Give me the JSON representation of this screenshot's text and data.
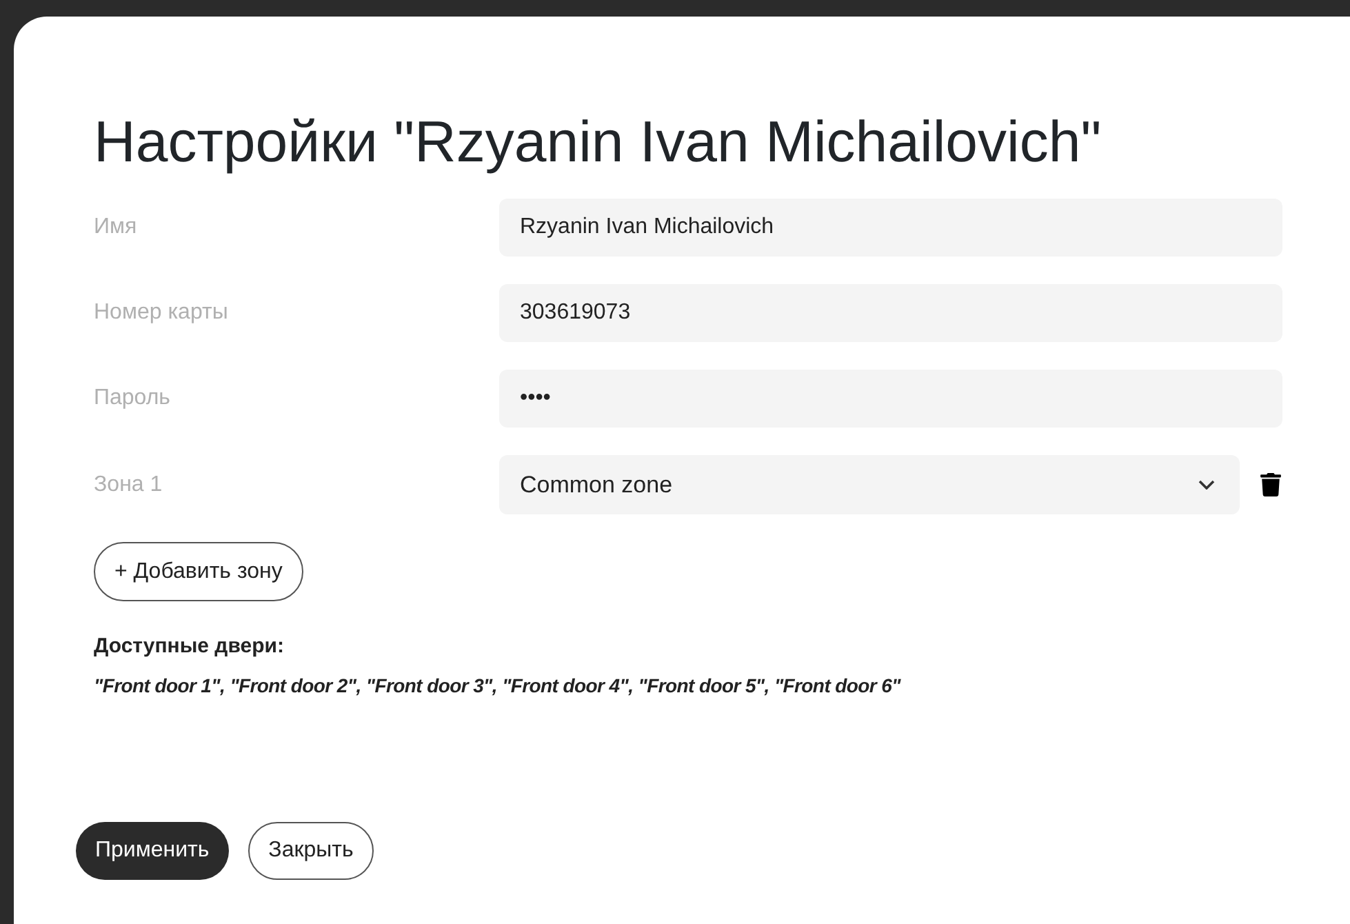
{
  "title": "Настройки \"Rzyanin Ivan Michailovich\"",
  "fields": [
    {
      "kind": "text",
      "label": "Имя",
      "value": "Rzyanin Ivan Michailovich"
    },
    {
      "kind": "text",
      "label": "Номер карты",
      "value": "303619073"
    },
    {
      "kind": "text",
      "label": "Пароль",
      "value": "••••"
    },
    {
      "kind": "select",
      "label": "Зона 1",
      "value": "Common zone"
    }
  ],
  "add_zone_button": "+ Добавить зону",
  "doors": {
    "heading": "Доступные двери:",
    "list": "\"Front door 1\", \"Front door 2\", \"Front door 3\", \"Front door 4\", \"Front door 5\", \"Front door 6\""
  },
  "buttons": [
    {
      "kind": "primary",
      "label": "Применить"
    },
    {
      "kind": "secondary",
      "label": "Закрыть"
    }
  ]
}
